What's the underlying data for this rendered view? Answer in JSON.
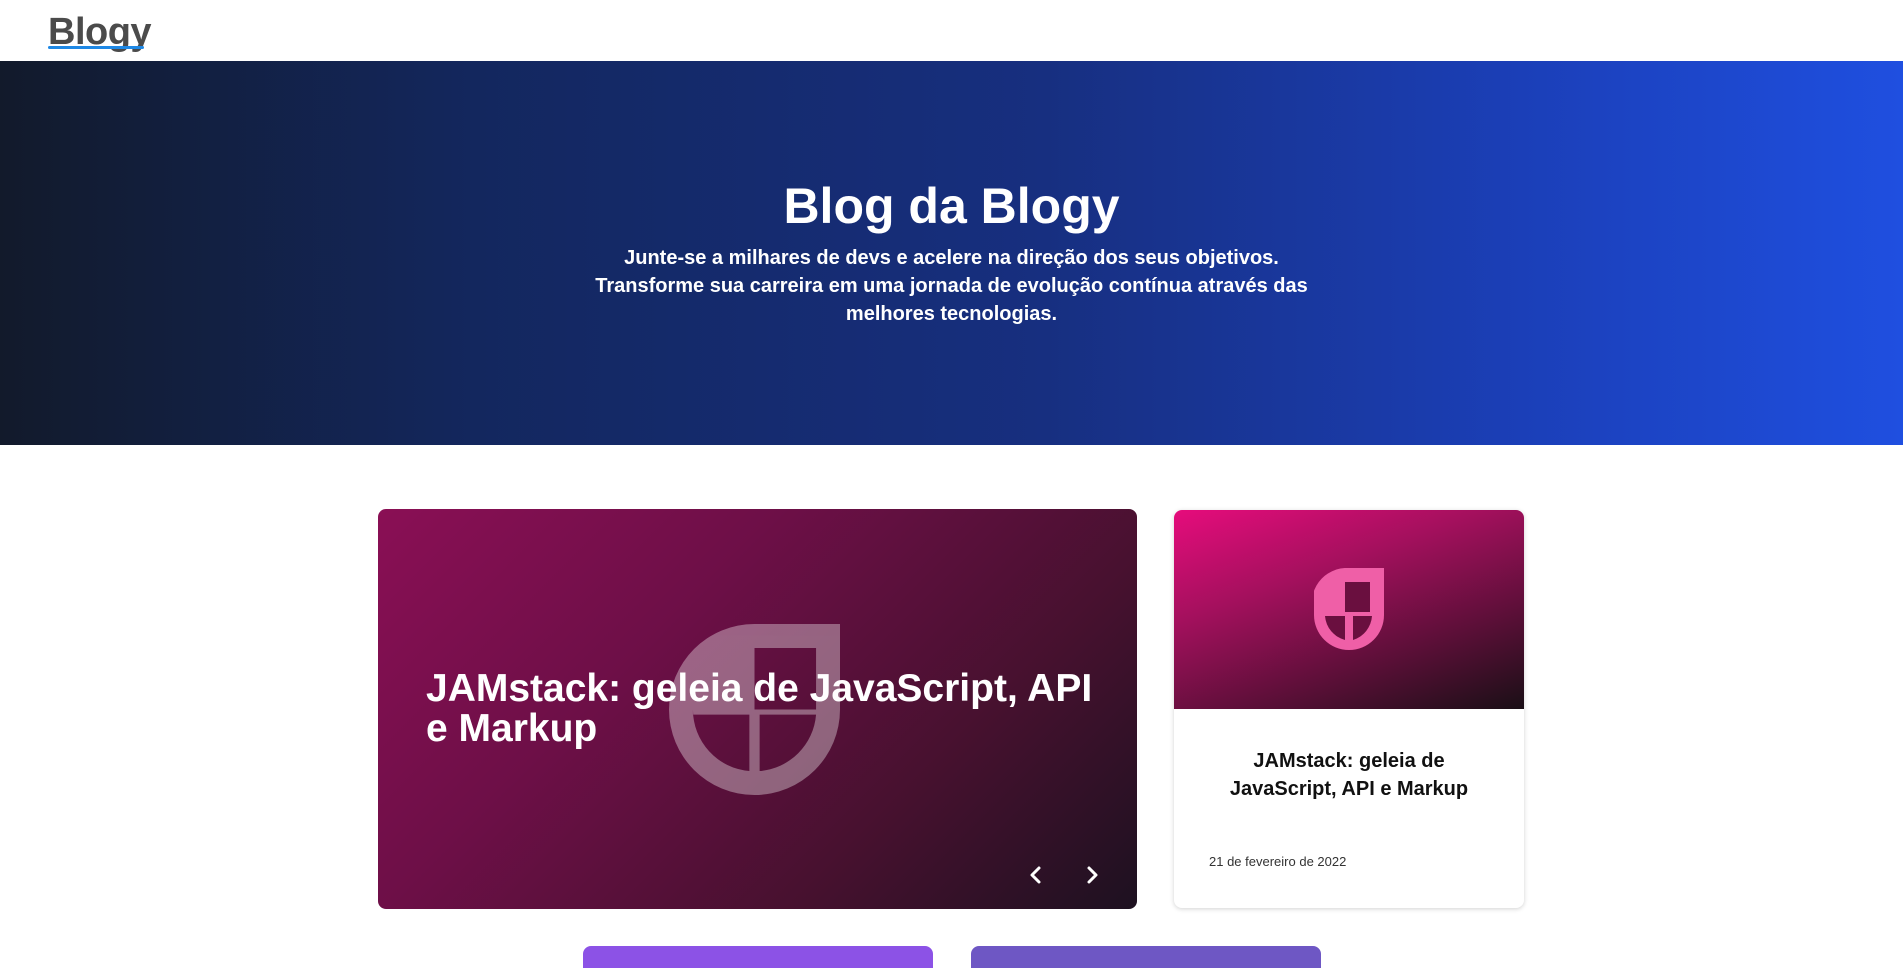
{
  "header": {
    "logo_text": "Blogy"
  },
  "hero": {
    "title": "Blog da Blogy",
    "subtitle": "Junte-se a milhares de devs e acelere na direção dos seus objetivos. Transforme sua carreira em uma jornada de evolução contínua através das melhores tecnologias."
  },
  "featured": {
    "title": "JAMstack: geleia de JavaScript, API e Markup",
    "icons": {
      "prev": "chevron-left-icon",
      "next": "chevron-right-icon",
      "watermark": "shield-logo-icon"
    }
  },
  "card": {
    "title": "JAMstack: geleia de JavaScript, API e Markup",
    "date": "21 de fevereiro de 2022",
    "icon": "shield-logo-icon"
  },
  "colors": {
    "hero_gradient_start": "#121a2b",
    "hero_gradient_end": "#1f4fe0",
    "logo_underline": "#1e88e5",
    "featured_gradient_start": "#8a0f55",
    "card_image_gradient_start": "#e60c7c",
    "tile_1": "#8c52e6",
    "tile_2": "#6e57c4"
  }
}
